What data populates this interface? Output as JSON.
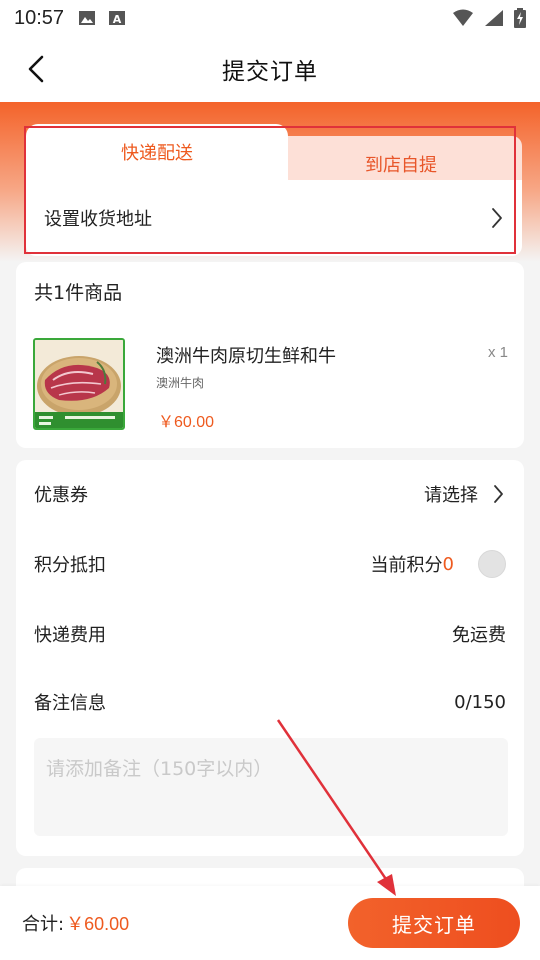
{
  "status": {
    "time": "10:57"
  },
  "nav": {
    "title": "提交订单"
  },
  "delivery": {
    "tab_express": "快递配送",
    "tab_pickup": "到店自提",
    "address_label": "设置收货地址"
  },
  "goods": {
    "count_label": "共1件商品",
    "items": [
      {
        "name": "澳洲牛肉原切生鲜和牛",
        "spec": "澳洲牛肉",
        "price": "￥60.00",
        "qty": "x 1"
      }
    ]
  },
  "options": {
    "coupon_label": "优惠券",
    "coupon_value": "请选择",
    "points_label": "积分抵扣",
    "points_prefix": "当前积分",
    "points_value": "0",
    "shipping_label": "快递费用",
    "shipping_value": "免运费",
    "remark_label": "备注信息",
    "remark_counter": "0/150",
    "remark_placeholder": "请添加备注（150字以内）"
  },
  "footer": {
    "total_label": "合计:",
    "total_value": "￥60.00",
    "submit_label": "提交订单"
  },
  "colors": {
    "accent": "#ee5a1f",
    "annotation": "#e0313a"
  }
}
